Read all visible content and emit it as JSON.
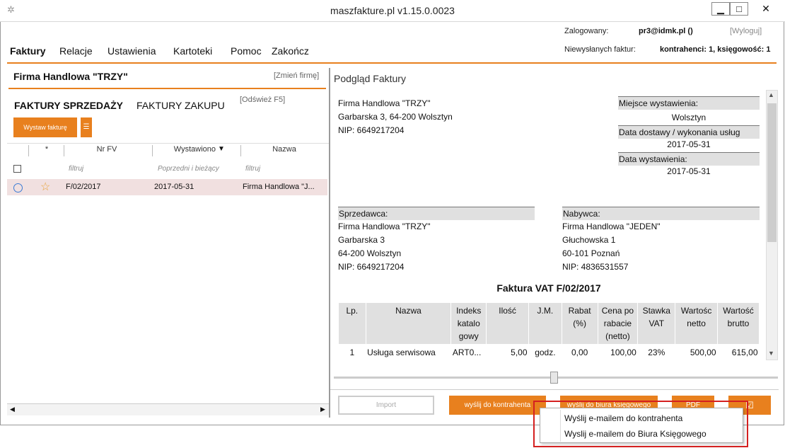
{
  "window": {
    "title": "maszfakture.pl  v1.15.0.0023",
    "min": "▁",
    "max": "□",
    "close": "✕"
  },
  "menu": [
    "Faktury",
    "Relacje",
    "Ustawienia",
    "Kartoteki",
    "Pomoc",
    "Zakończ"
  ],
  "login": {
    "label": "Zalogowany:",
    "user": "pr3@idmk.pl ()",
    "logout": "[Wyloguj]"
  },
  "unsent": {
    "label": "Niewysłanych faktur:",
    "value": "kontrahenci: 1, księgowość: 1"
  },
  "company": {
    "name": "Firma Handlowa \"TRZY\"",
    "change": "[Zmień firmę]"
  },
  "tabs": {
    "sales": "FAKTURY SPRZEDAŻY",
    "purchase": "FAKTURY ZAKUPU",
    "refresh": "[Odśwież F5]"
  },
  "buttons": {
    "issue": "Wystaw fakturę",
    "list": "☰"
  },
  "columns": {
    "star": "*",
    "nr": "Nr FV",
    "issued": "Wystawiono",
    "name": "Nazwa"
  },
  "filters": {
    "nr": "filtruj",
    "issued": "Poprzedni i bieżący",
    "name": "filtruj"
  },
  "row": {
    "nr": "F/02/2017",
    "date": "2017-05-31",
    "name": "Firma Handlowa \"J..."
  },
  "preview": {
    "title": "Podgląd Faktury",
    "issuer": [
      "Firma Handlowa \"TRZY\"",
      "Garbarska 3, 64-200 Wolsztyn",
      "NIP: 6649217204"
    ],
    "place_label": "Miejsce wystawienia:",
    "place": "Wolsztyn",
    "delivery_label": "Data dostawy / wykonania usług",
    "delivery": "2017-05-31",
    "issue_label": "Data wystawienia:",
    "issue": "2017-05-31",
    "seller_label": "Sprzedawca:",
    "seller": [
      "Firma Handlowa \"TRZY\"",
      "Garbarska 3",
      "64-200 Wolsztyn",
      "NIP: 6649217204"
    ],
    "buyer_label": "Nabywca:",
    "buyer": [
      "Firma Handlowa \"JEDEN\"",
      "Głuchowska 1",
      "60-101 Poznań",
      "NIP: 4836531557"
    ],
    "invoice_title": "Faktura VAT F/02/2017",
    "table_headers": [
      "Lp.",
      "Nazwa",
      "Indeks katalo gowy",
      "Ilość",
      "J.M.",
      "Rabat (%)",
      "Cena po rabacie (netto)",
      "Stawka VAT",
      "Wartośc netto",
      "Wartość brutto"
    ],
    "rows": [
      [
        "1",
        "Usługa serwisowa",
        "ART0...",
        "5,00",
        "godz.",
        "0,00",
        "100,00",
        "23%",
        "500,00",
        "615,00"
      ]
    ]
  },
  "bottom": {
    "import": "Import",
    "send_client": "wyślij do kontrahenta",
    "send_office": "wyślij do biura księgowego",
    "pdf": "PDF",
    "check": "☑"
  },
  "popup": {
    "item1": "Wyślij e-mailem do kontrahenta",
    "item2": "Wyslij e-mailem do Biura Księgowego"
  }
}
